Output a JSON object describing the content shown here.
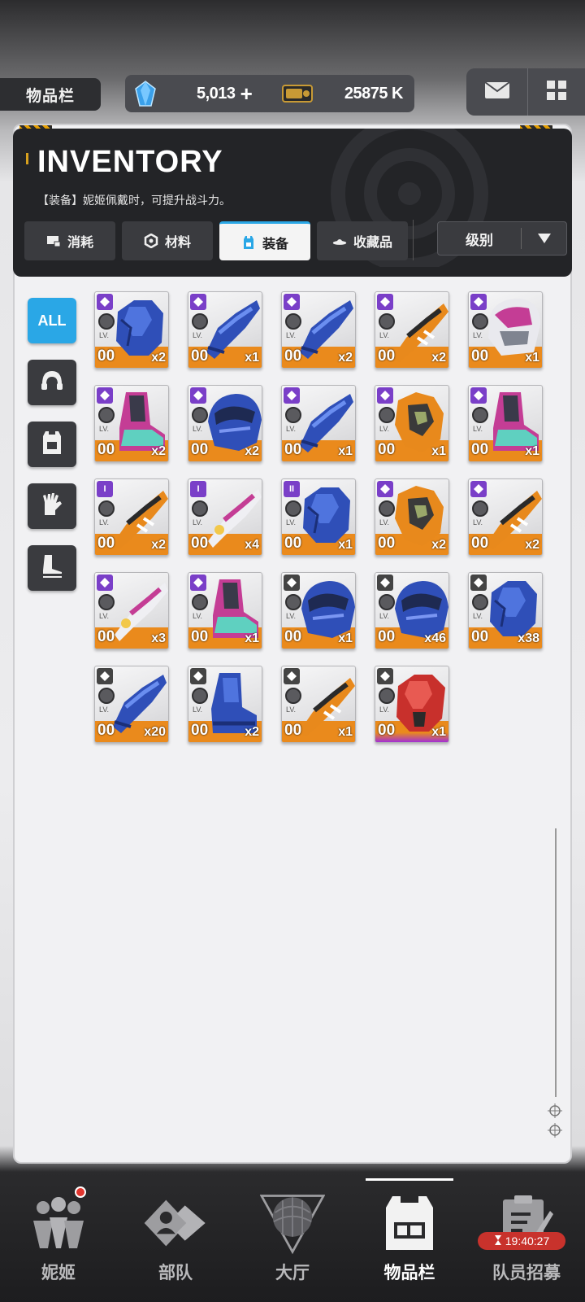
{
  "topbar": {
    "title": "物品栏",
    "gem_value": "5,013",
    "gem_plus": "+",
    "coin_value": "25875 K"
  },
  "header": {
    "title": "INVENTORY",
    "description": "【装备】妮姬佩戴时，可提升战斗力。"
  },
  "tabs": [
    {
      "label": "消耗",
      "icon": "consumable-icon"
    },
    {
      "label": "材料",
      "icon": "material-icon"
    },
    {
      "label": "装备",
      "icon": "equipment-icon",
      "active": true
    },
    {
      "label": "收藏品",
      "icon": "collectible-icon"
    }
  ],
  "sort": {
    "label": "级别"
  },
  "filters": {
    "all_label": "ALL",
    "items": [
      "helmet-icon",
      "vest-icon",
      "glove-icon",
      "boot-icon"
    ]
  },
  "items": [
    {
      "lv": "00",
      "qty": "x2",
      "rarity": "purple",
      "art": "blue-torso"
    },
    {
      "lv": "00",
      "qty": "x1",
      "rarity": "purple",
      "art": "blue-arm"
    },
    {
      "lv": "00",
      "qty": "x2",
      "rarity": "purple",
      "art": "blue-arm"
    },
    {
      "lv": "00",
      "qty": "x2",
      "rarity": "purple",
      "art": "orange-arm"
    },
    {
      "lv": "00",
      "qty": "x1",
      "rarity": "purple",
      "art": "pink-helmet"
    },
    {
      "lv": "00",
      "qty": "x2",
      "rarity": "purple",
      "art": "pink-boot"
    },
    {
      "lv": "00",
      "qty": "x2",
      "rarity": "purple",
      "art": "blue-helmet"
    },
    {
      "lv": "00",
      "qty": "x1",
      "rarity": "purple",
      "art": "blue-arm"
    },
    {
      "lv": "00",
      "qty": "x1",
      "rarity": "purple",
      "art": "orange-torso"
    },
    {
      "lv": "00",
      "qty": "x1",
      "rarity": "purple",
      "art": "pink-boot"
    },
    {
      "lv": "00",
      "qty": "x2",
      "rarity": "purple",
      "art": "orange-arm",
      "badge": "I"
    },
    {
      "lv": "00",
      "qty": "x4",
      "rarity": "purple",
      "art": "pink-arm",
      "badge": "I"
    },
    {
      "lv": "00",
      "qty": "x1",
      "rarity": "purple",
      "art": "blue-torso",
      "badge": "II"
    },
    {
      "lv": "00",
      "qty": "x2",
      "rarity": "purple",
      "art": "orange-torso"
    },
    {
      "lv": "00",
      "qty": "x2",
      "rarity": "purple",
      "art": "orange-arm"
    },
    {
      "lv": "00",
      "qty": "x3",
      "rarity": "purple",
      "art": "pink-arm"
    },
    {
      "lv": "00",
      "qty": "x1",
      "rarity": "purple",
      "art": "pink-boot"
    },
    {
      "lv": "00",
      "qty": "x1",
      "rarity": "gray",
      "art": "blue-helmet"
    },
    {
      "lv": "00",
      "qty": "x46",
      "rarity": "gray",
      "art": "blue-helmet"
    },
    {
      "lv": "00",
      "qty": "x38",
      "rarity": "gray",
      "art": "blue-torso"
    },
    {
      "lv": "00",
      "qty": "x20",
      "rarity": "gray",
      "art": "blue-arm"
    },
    {
      "lv": "00",
      "qty": "x2",
      "rarity": "gray",
      "art": "blue-boot"
    },
    {
      "lv": "00",
      "qty": "x1",
      "rarity": "gray",
      "art": "orange-arm"
    },
    {
      "lv": "00",
      "qty": "x1",
      "rarity": "gray",
      "art": "red-torso",
      "special": true
    }
  ],
  "lv_label": "LV.",
  "nav": [
    {
      "label": "妮姬",
      "icon": "nikke-icon",
      "dot": true
    },
    {
      "label": "部队",
      "icon": "squad-icon"
    },
    {
      "label": "大厅",
      "icon": "lobby-icon"
    },
    {
      "label": "物品栏",
      "icon": "inventory-icon",
      "active": true
    },
    {
      "label": "队员招募",
      "icon": "recruit-icon",
      "timer": "19:40:27"
    }
  ],
  "colors": {
    "accent": "#2aa7e6",
    "orange_strip": "#ea8a1c",
    "rarity_purple": "#7a3fc8",
    "timer_red": "#c8322c"
  }
}
